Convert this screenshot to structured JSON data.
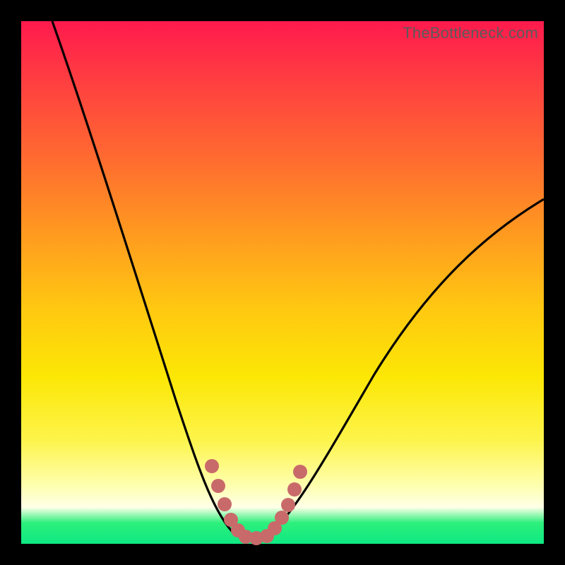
{
  "watermark": "TheBottleneck.com",
  "colors": {
    "background": "#000000",
    "gradient_top": "#ff1a4d",
    "gradient_mid": "#fce705",
    "gradient_bottom": "#0ee882",
    "curve": "#000000",
    "marker": "#c96a6a"
  },
  "chart_data": {
    "type": "line",
    "title": "",
    "xlabel": "",
    "ylabel": "",
    "xlim": [
      0,
      100
    ],
    "ylim": [
      0,
      100
    ],
    "note": "Axes unlabeled; values are relative percentages read from pixel position. y=0 is the green minimum band; y=100 is the top of the gradient.",
    "series": [
      {
        "name": "bottleneck-curve",
        "x": [
          6,
          10,
          14,
          18,
          22,
          26,
          30,
          34,
          36,
          38,
          40,
          42,
          44,
          46,
          48,
          52,
          56,
          60,
          66,
          74,
          82,
          90,
          100
        ],
        "y": [
          100,
          90,
          80,
          70,
          60,
          49,
          38,
          24,
          17,
          10,
          5,
          2,
          1,
          1,
          2,
          5,
          11,
          18,
          28,
          40,
          50,
          58,
          66
        ]
      }
    ],
    "markers": {
      "name": "highlighted-range",
      "x": [
        36.5,
        37.8,
        39.0,
        40.2,
        41.5,
        43.0,
        45.0,
        47.0,
        48.5,
        49.8,
        51.0,
        52.2,
        53.3
      ],
      "y": [
        15,
        11,
        7.5,
        4.5,
        2.5,
        1.2,
        1,
        1.5,
        3,
        5,
        7.5,
        10.5,
        14
      ]
    }
  }
}
